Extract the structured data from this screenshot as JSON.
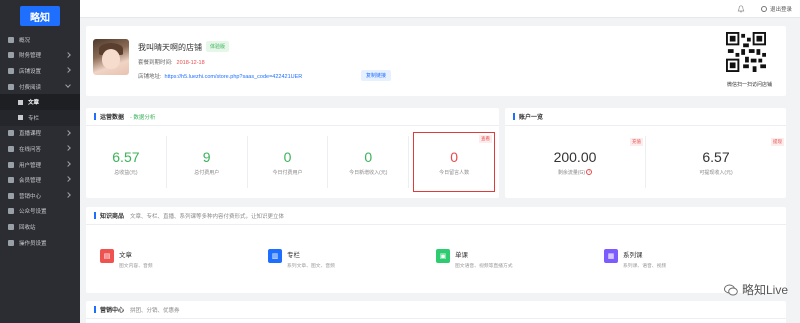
{
  "sidebar": {
    "logo": "略知",
    "items": [
      {
        "label": "概况",
        "icon": "home-icon",
        "chevron": false
      },
      {
        "label": "財务管理",
        "icon": "money-icon",
        "chevron": true
      },
      {
        "label": "店铺设置",
        "icon": "store-icon",
        "chevron": true
      },
      {
        "label": "付费阅读",
        "icon": "book-icon",
        "chevron": true,
        "open": true
      }
    ],
    "subitems": [
      {
        "label": "文章",
        "icon": "doc-icon",
        "active": true
      },
      {
        "label": "专栏",
        "icon": "column-icon",
        "active": false
      }
    ],
    "items2": [
      {
        "label": "直播课程",
        "icon": "live-icon",
        "chevron": true
      },
      {
        "label": "在线问答",
        "icon": "qa-icon",
        "chevron": true
      },
      {
        "label": "用户管理",
        "icon": "user-icon",
        "chevron": true
      },
      {
        "label": "会员管理",
        "icon": "vip-icon",
        "chevron": true
      },
      {
        "label": "营销中心",
        "icon": "marketing-icon",
        "chevron": true
      },
      {
        "label": "公众号设置",
        "icon": "wechat-icon",
        "chevron": false
      },
      {
        "label": "回收站",
        "icon": "trash-icon",
        "chevron": false
      },
      {
        "label": "操作员设置",
        "icon": "operator-icon",
        "chevron": false
      }
    ]
  },
  "topbar": {
    "logout": "退出登录"
  },
  "store": {
    "name": "我叫晴天啊的店铺",
    "badge": "体验版",
    "expiry_label": "套餐到期时间:",
    "expiry_date": "2018-12-18",
    "addr_label": "店铺地址:",
    "url": "https://h5.luezhi.com/store.php?saas_code=422421UER",
    "copy": "复制链接",
    "qr_label": "微信扫一扫访问店铺"
  },
  "ops": {
    "title": "运营数据",
    "sub": "- 数据分析",
    "stats": [
      {
        "value": "6.57",
        "label": "总收益(元)"
      },
      {
        "value": "9",
        "label": "总付费用户"
      },
      {
        "value": "0",
        "label": "今日付费用户"
      },
      {
        "value": "0",
        "label": "今日新增收入(元)"
      },
      {
        "value": "0",
        "label": "今日留言人数",
        "tag": "查看"
      }
    ]
  },
  "account": {
    "title": "账户一览",
    "stats": [
      {
        "value": "200.00",
        "label": "剩余流量(G)",
        "tag": "充值"
      },
      {
        "value": "6.57",
        "label": "可提现收入(元)",
        "tag": "提现"
      }
    ]
  },
  "knowledge": {
    "title": "知识商品",
    "sub": "文章、专栏、直播、系列课等多种内容付费形式，让知识更立体",
    "items": [
      {
        "name": "文章",
        "desc": "图文内容、音频",
        "color": "#ef5350",
        "icon": "article-icon"
      },
      {
        "name": "专栏",
        "desc": "系列文章、图文、音频",
        "color": "#1f6fff",
        "icon": "column-icon"
      },
      {
        "name": "单课",
        "desc": "图文语音、视频等直播方式",
        "color": "#2ecc71",
        "icon": "lesson-icon"
      },
      {
        "name": "系列课",
        "desc": "系列课、语音、视频",
        "color": "#7c5cff",
        "icon": "series-icon"
      }
    ]
  },
  "marketing": {
    "title": "营销中心",
    "sub": "拼团、分销、优惠券"
  },
  "watermark": "略知Live"
}
